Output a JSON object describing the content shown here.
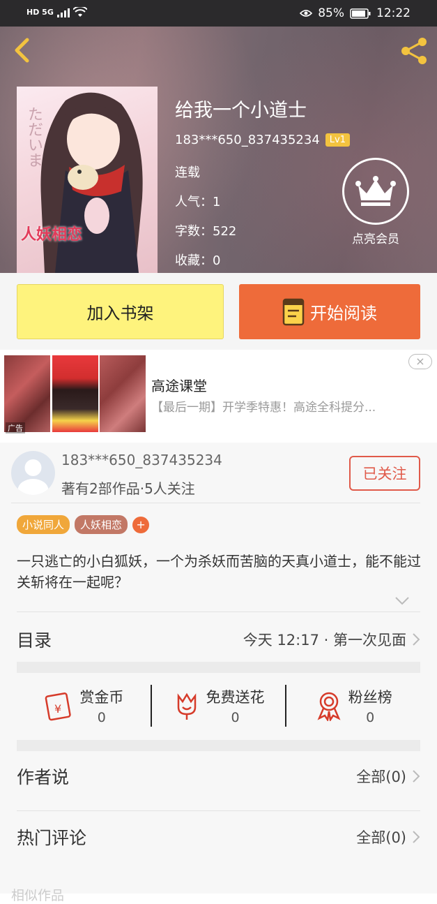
{
  "status_bar": {
    "left_badges": "HD 5G",
    "battery_percent": "85%",
    "time": "12:22"
  },
  "header": {
    "book_title": "给我一个小道士",
    "author": "183***650_837435234",
    "level": "Lv1",
    "status": "连载",
    "popularity": "人气：1",
    "word_count": "字数：522",
    "favorites": "收藏：0",
    "vip_label": "点亮会员",
    "cover_text": "人妖相恋",
    "cover_jp": "ただいま"
  },
  "buttons": {
    "add_shelf": "加入书架",
    "start_read": "开始阅读"
  },
  "ad": {
    "title": "高途课堂",
    "desc": "【最后一期】开学季特惠！高途全科提分...",
    "tag": "广告",
    "close": "×"
  },
  "author_card": {
    "name": "183***650_837435234",
    "stats": "著有2部作品·5人关注",
    "follow_label": "已关注"
  },
  "tags": [
    {
      "label": "小说同人",
      "color": "#f0a73a"
    },
    {
      "label": "人妖相恋",
      "color": "#c27866"
    }
  ],
  "tag_add": "+",
  "description": "一只逃亡的小白狐妖，一个为杀妖而苦脑的天真小道士，能不能过关斩将在一起呢？",
  "catalog": {
    "title": "目录",
    "latest": "今天 12:17 · 第一次见面"
  },
  "stats": [
    {
      "label": "赏金币",
      "value": "0",
      "icon": "red-envelope-icon"
    },
    {
      "label": "免费送花",
      "value": "0",
      "icon": "flower-icon"
    },
    {
      "label": "粉丝榜",
      "value": "0",
      "icon": "medal-icon"
    }
  ],
  "author_says": {
    "title": "作者说",
    "all": "全部(0)"
  },
  "hot_comments": {
    "title": "热门评论",
    "all": "全部(0)"
  },
  "similar": {
    "title": "相似作品"
  },
  "colors": {
    "accent": "#ee6b3a",
    "shelf_yellow": "#fef37d",
    "icon_red": "#d63b2a",
    "header_gold": "#f3c33f"
  }
}
